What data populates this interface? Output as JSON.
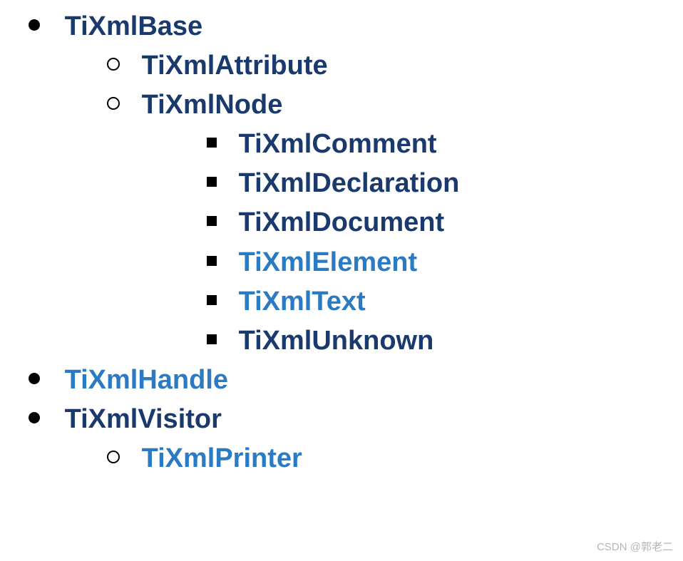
{
  "tree": {
    "tixmlbase": "TiXmlBase",
    "tixmlattribute": "TiXmlAttribute",
    "tixmlnode": "TiXmlNode",
    "tixmlcomment": "TiXmlComment",
    "tixmldeclaration": "TiXmlDeclaration",
    "tixmldocument": "TiXmlDocument",
    "tixmlelement": "TiXmlElement",
    "tixmltext": "TiXmlText",
    "tixmlunknown": "TiXmlUnknown",
    "tixmlhandle": "TiXmlHandle",
    "tixmlvisitor": "TiXmlVisitor",
    "tixmlprinter": "TiXmlPrinter"
  },
  "watermark": "CSDN @郭老二"
}
